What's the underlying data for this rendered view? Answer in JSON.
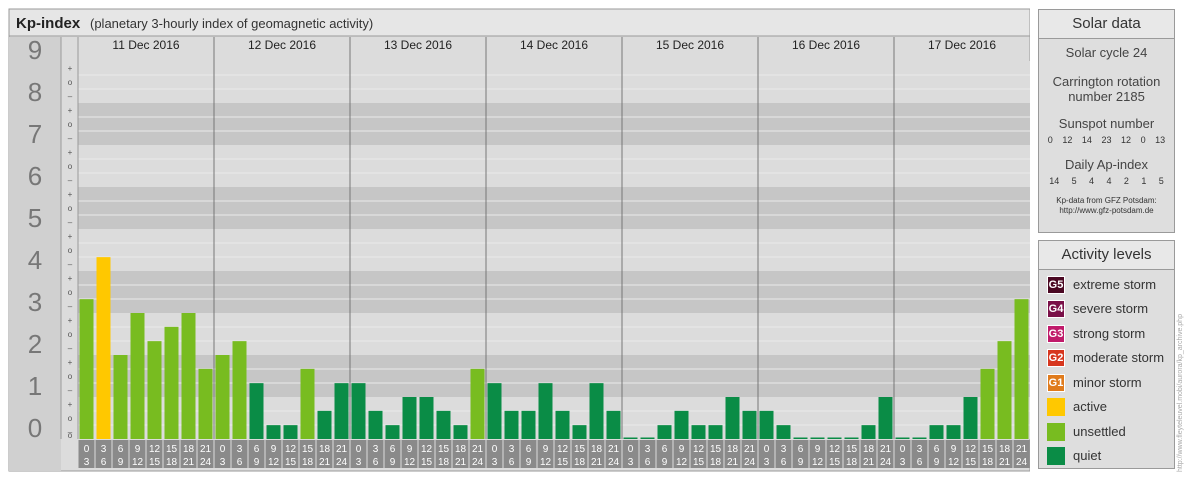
{
  "chart_data": {
    "type": "bar",
    "title": "Kp-index",
    "subtitle": "(planetary 3-hourly index of geomagnetic activity)",
    "ylim": [
      0,
      9
    ],
    "y_major_ticks": [
      "0",
      "1",
      "2",
      "3",
      "4",
      "5",
      "6",
      "7",
      "8",
      "9"
    ],
    "y_minor_ticks": [
      "+",
      "o",
      "–"
    ],
    "days": [
      "11 Dec 2016",
      "12 Dec 2016",
      "13 Dec 2016",
      "14 Dec 2016",
      "15 Dec 2016",
      "16 Dec 2016",
      "17 Dec 2016"
    ],
    "interval_start": [
      "0",
      "3",
      "6",
      "9",
      "12",
      "15",
      "18",
      "21"
    ],
    "interval_end": [
      "3",
      "6",
      "9",
      "12",
      "15",
      "18",
      "21",
      "24"
    ],
    "values": [
      3.33,
      4.33,
      2.0,
      3.0,
      2.33,
      2.67,
      3.0,
      1.67,
      2.0,
      2.33,
      1.33,
      0.33,
      0.33,
      1.67,
      0.67,
      1.33,
      1.33,
      0.67,
      0.33,
      1.0,
      1.0,
      0.67,
      0.33,
      1.67,
      1.33,
      0.67,
      0.67,
      1.33,
      0.67,
      0.33,
      1.33,
      0.67,
      0.0,
      0.0,
      0.33,
      0.67,
      0.33,
      0.33,
      1.0,
      0.67,
      0.67,
      0.33,
      0.0,
      0.0,
      0.0,
      0.0,
      0.33,
      1.0,
      0.0,
      0.0,
      0.33,
      0.33,
      1.0,
      1.67,
      2.33,
      3.33
    ],
    "colors": {
      "quiet": "#0a8c46",
      "unsettled": "#78bc20",
      "active": "#ffc800",
      "G1": "#e07b1c",
      "G2": "#d7361e",
      "G3": "#c01a6a",
      "G4": "#7a1048",
      "G5": "#4a0822"
    }
  },
  "solar_data": {
    "title": "Solar data",
    "cycle": "Solar cycle 24",
    "carrington_line1": "Carrington rotation",
    "carrington_line2": "number 2185",
    "sunspot_label": "Sunspot number",
    "sunspot_values": [
      "0",
      "12",
      "14",
      "23",
      "12",
      "0",
      "13"
    ],
    "ap_label": "Daily Ap-index",
    "ap_values": [
      "14",
      "5",
      "4",
      "4",
      "2",
      "1",
      "5"
    ],
    "source_line1": "Kp-data from GFZ Potsdam:",
    "source_line2": "http://www.gfz-potsdam.de"
  },
  "activity_levels": {
    "title": "Activity levels",
    "items": [
      {
        "code": "G5",
        "label": "extreme storm",
        "color": "#4a0822"
      },
      {
        "code": "G4",
        "label": "severe storm",
        "color": "#7a1048"
      },
      {
        "code": "G3",
        "label": "strong storm",
        "color": "#c01a6a"
      },
      {
        "code": "G2",
        "label": "moderate storm",
        "color": "#d7361e"
      },
      {
        "code": "G1",
        "label": "minor storm",
        "color": "#e07b1c"
      },
      {
        "code": "",
        "label": "active",
        "color": "#ffc800"
      },
      {
        "code": "",
        "label": "unsettled",
        "color": "#78bc20"
      },
      {
        "code": "",
        "label": "quiet",
        "color": "#0a8c46"
      }
    ]
  },
  "watermark": "http://www.fleyteleuvel.mobi/aurora/kp_archive.php"
}
